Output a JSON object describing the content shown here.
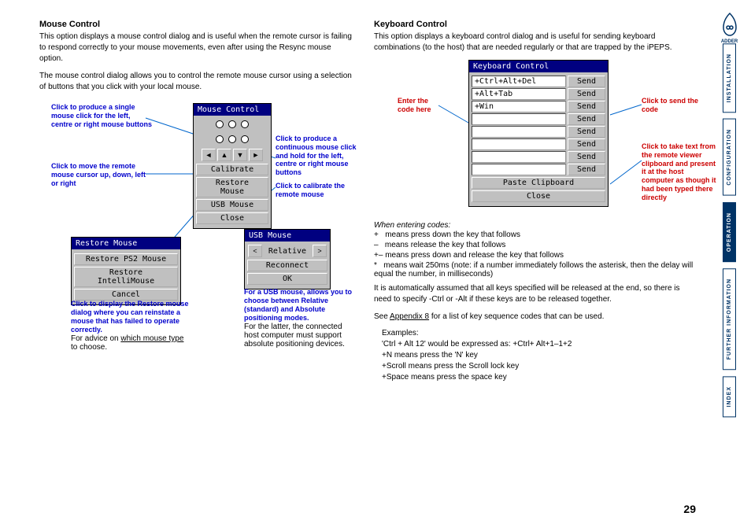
{
  "pageNumber": "29",
  "logo": "ADDER",
  "nav": {
    "items": [
      "INSTALLATION",
      "CONFIGURATION",
      "OPERATION",
      "FURTHER INFORMATION",
      "INDEX"
    ]
  },
  "left": {
    "heading": "Mouse Control",
    "para1": "This option displays a mouse control dialog and is useful when the remote cursor is failing to respond correctly to your mouse movements, even after using the Resync mouse option.",
    "para2": "The mouse control dialog allows you to control the remote mouse cursor using a selection of buttons that you click with your local mouse.",
    "mouseDialog": {
      "title": "Mouse Control",
      "buttons": {
        "calibrate": "Calibrate",
        "restore": "Restore Mouse",
        "usb": "USB Mouse",
        "close": "Close"
      }
    },
    "restoreDialog": {
      "title": "Restore Mouse",
      "buttons": {
        "ps2": "Restore PS2 Mouse",
        "intelli": "Restore IntelliMouse",
        "cancel": "Cancel"
      }
    },
    "usbDialog": {
      "title": "USB Mouse",
      "mode": "Relative",
      "buttons": {
        "reconnect": "Reconnect",
        "ok": "OK"
      }
    },
    "annotations": {
      "singleClick": "Click to produce a single mouse click for the left, centre or right mouse buttons",
      "continuousClick": "Click to produce a continuous mouse click and hold for the left, centre or right mouse buttons",
      "moveCursor": "Click to move the remote mouse cursor up, down, left or right",
      "calibrate": "Click to calibrate the remote mouse",
      "restoreInfo": "Click to display the Restore mouse dialog where you can reinstate a mouse that has failed to operate correctly.",
      "adviceText": "For advice on ",
      "adviceLink": "which mouse type",
      "adviceEnd": " to choose.",
      "usbInfo": "For a USB mouse, allows you to choose between Relative (standard) and Absolute positioning modes.",
      "usbNote": "For the latter, the connected host computer must support absolute positioning devices."
    }
  },
  "right": {
    "heading": "Keyboard Control",
    "para1": "This option displays a keyboard control dialog and is useful for sending keyboard combinations (to the host) that are needed regularly or that are trapped by the iPEPS.",
    "kbDialog": {
      "title": "Keyboard Control",
      "rows": [
        "+Ctrl+Alt+Del",
        "+Alt+Tab",
        "+Win",
        "",
        "",
        "",
        "",
        ""
      ],
      "send": "Send",
      "paste": "Paste Clipboard",
      "close": "Close"
    },
    "annotations": {
      "enterCode": "Enter the code here",
      "clickSend": "Click to send the code",
      "pasteInfo": "Click to take text from the remote viewer clipboard and present it at the host computer as though it had been typed there directly"
    },
    "codesHeading": "When entering codes:",
    "codes": {
      "plus": "means press down the key that follows",
      "minus": "means release the key that follows",
      "plusminus": "means press down and release the key that follows",
      "star": "means wait 250ms (note: if a number immediately follows the asterisk, then the delay will equal the number, in milliseconds)"
    },
    "autoRelease": "It is automatically assumed that all keys specified will be released at the end, so there is need to specify -Ctrl or -Alt if these keys are to be released together.",
    "seeText": "See ",
    "appendixLink": "Appendix 8",
    "seeEnd": " for a list of key sequence codes that can be used.",
    "examplesHeading": "Examples:",
    "examples": [
      "'Ctrl + Alt 12' would be expressed as: +Ctrl+ Alt+1–1+2",
      "+N means press the 'N' key",
      "+Scroll means press the Scroll lock key",
      "+Space means press the space key"
    ]
  }
}
